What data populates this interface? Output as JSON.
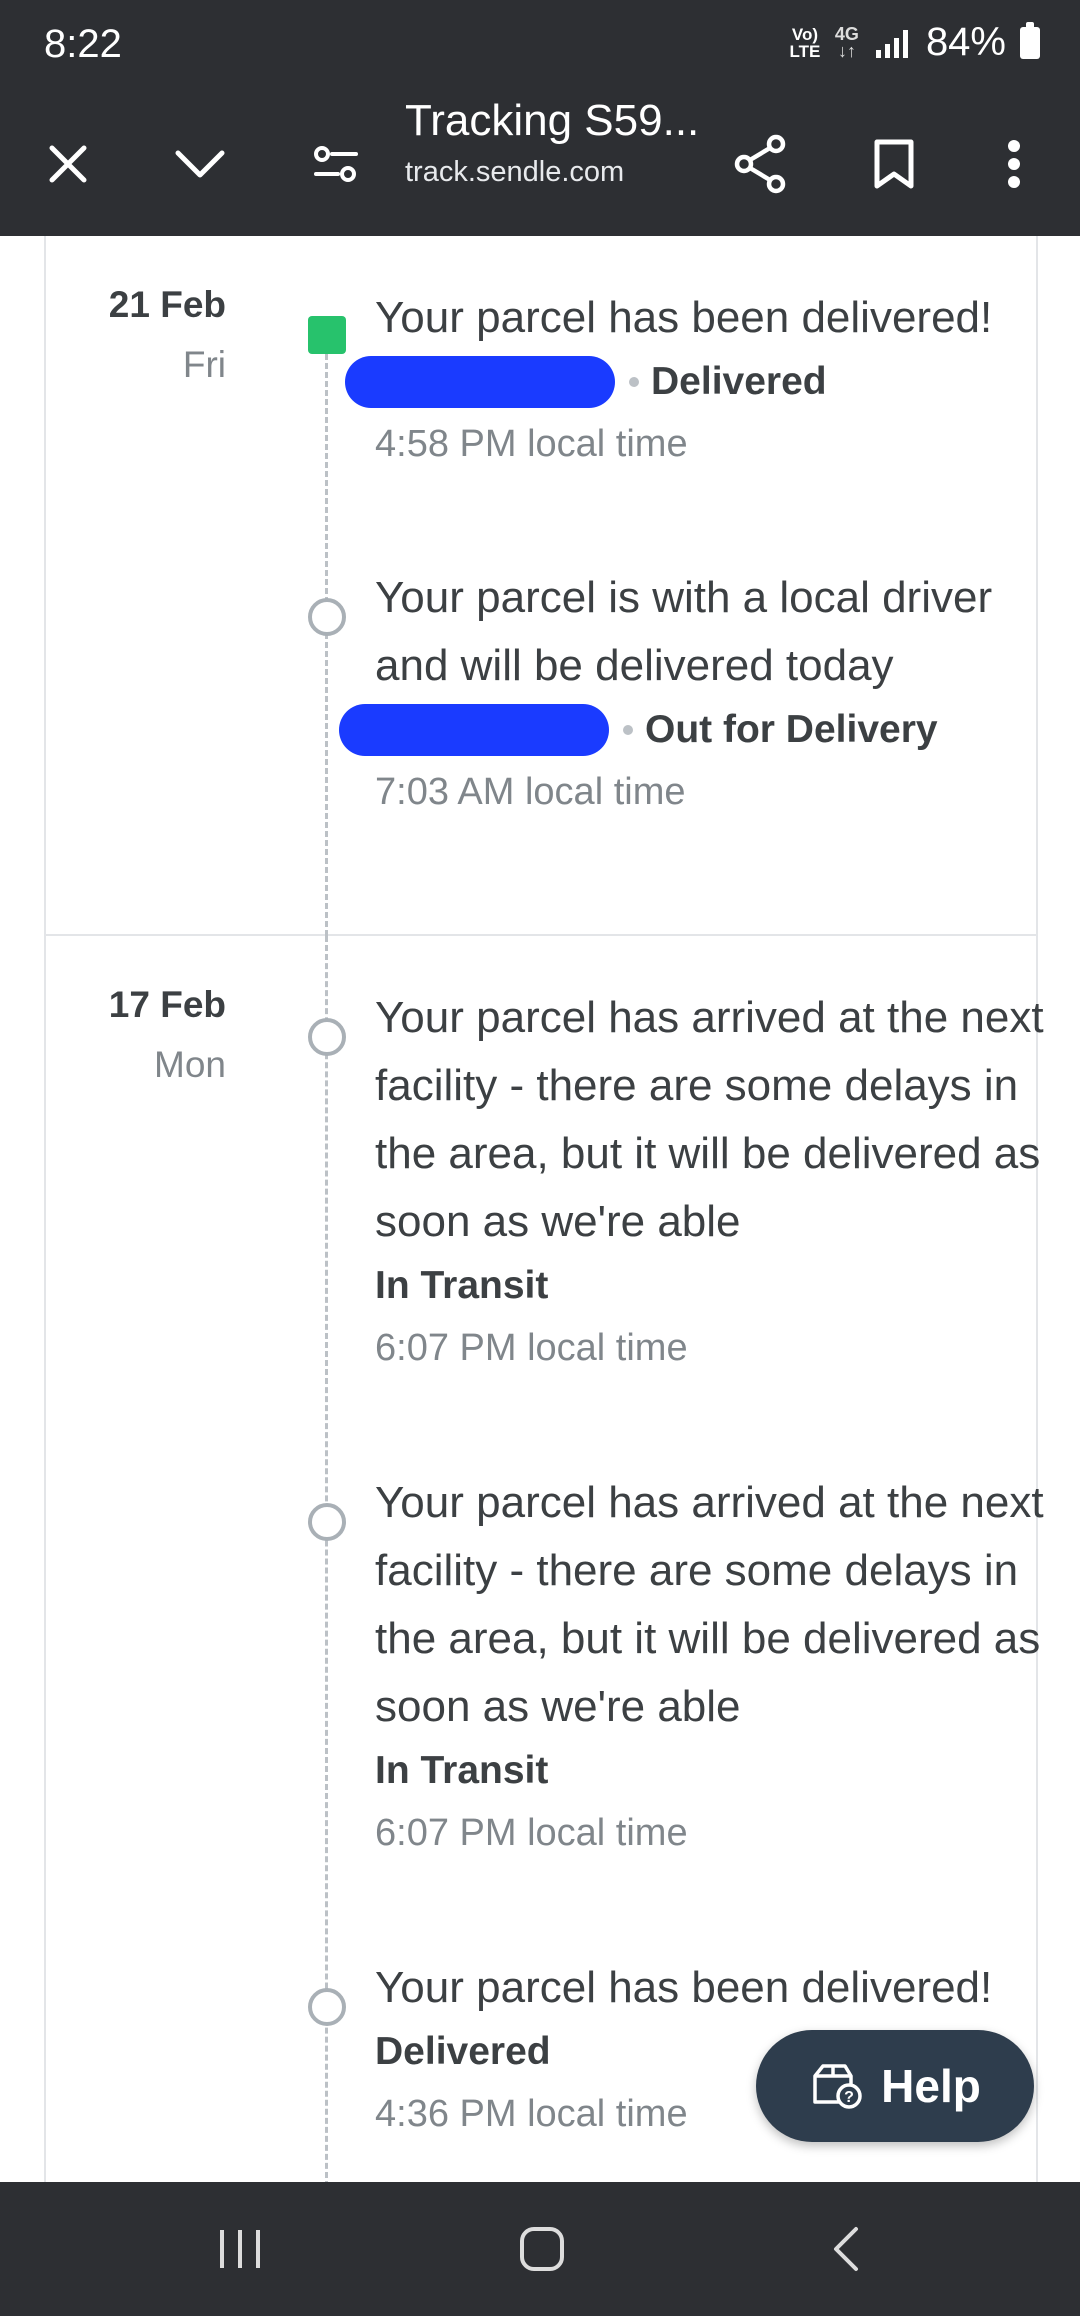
{
  "status_bar": {
    "time": "8:22",
    "volte": "Vo) LTE",
    "network": "4G",
    "battery": "84%"
  },
  "toolbar": {
    "title": "Tracking S59...",
    "url": "track.sendle.com"
  },
  "groups": [
    {
      "date": "21 Feb",
      "weekday": "Fri",
      "events": [
        {
          "message": "Your parcel has been delivered!",
          "status": "Delivered",
          "time": "4:58 PM local time",
          "redacted_location": true,
          "marker": "current"
        },
        {
          "message": "Your parcel is with a local driver and will be delivered today",
          "status": "Out for Delivery",
          "time": "7:03 AM local time",
          "redacted_location": true,
          "marker": "past"
        }
      ]
    },
    {
      "date": "17 Feb",
      "weekday": "Mon",
      "events": [
        {
          "message": "Your parcel has arrived at the next facility - there are some delays in the area, but it will be delivered as soon as we're able",
          "status": "In Transit",
          "time": "6:07 PM local time",
          "marker": "past"
        },
        {
          "message": "Your parcel has arrived at the next facility - there are some delays in the area, but it will be delivered as soon as we're able",
          "status": "In Transit",
          "time": "6:07 PM local time",
          "marker": "past"
        },
        {
          "message": "Your parcel has been delivered!",
          "status": "Delivered",
          "time": "4:36 PM local time",
          "marker": "past"
        }
      ]
    }
  ],
  "help_button": {
    "label": "Help"
  },
  "colors": {
    "chrome": "#2d2f33",
    "current_marker": "#27c26c",
    "help_bg": "#2e3d4d",
    "redaction": "#1a3bff"
  }
}
